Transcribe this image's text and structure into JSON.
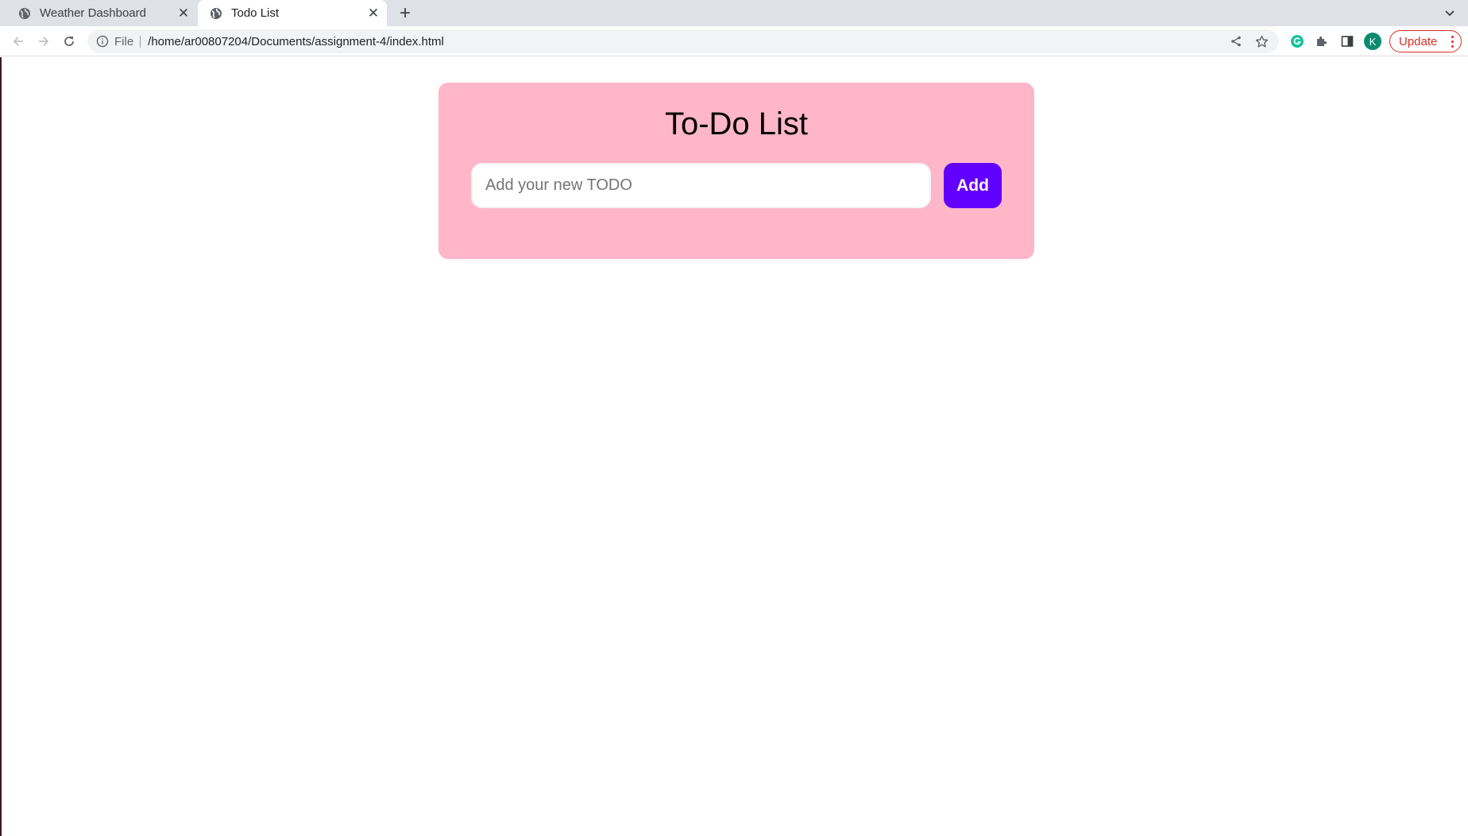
{
  "browser": {
    "tabs": [
      {
        "title": "Weather Dashboard",
        "active": false
      },
      {
        "title": "Todo List",
        "active": true
      }
    ],
    "close_glyph": "✕",
    "new_tab_glyph": "+",
    "address": {
      "scheme_label": "File",
      "url": "/home/ar00807204/Documents/assignment-4/index.html"
    },
    "profile_initial": "K",
    "update_label": "Update",
    "colors": {
      "update": "#d93025",
      "avatar": "#0b8a6f",
      "grammarly": "#15c39a"
    }
  },
  "app": {
    "title": "To-Do List",
    "input": {
      "placeholder": "Add your new TODO",
      "value": ""
    },
    "add_label": "Add",
    "colors": {
      "card_background": "#ffb6c8",
      "add_button": "#6200ff"
    }
  }
}
